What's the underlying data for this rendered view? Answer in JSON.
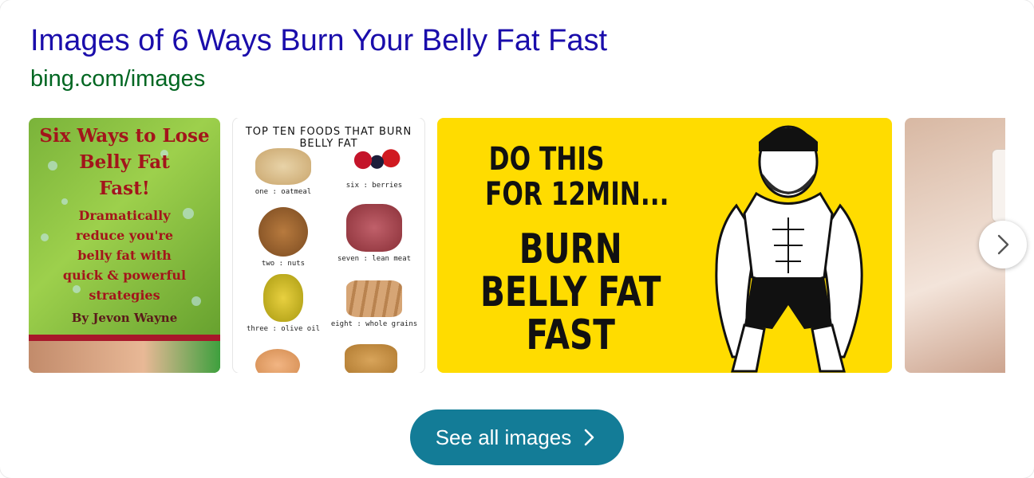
{
  "header": {
    "title": "Images of 6 Ways Burn Your Belly Fat Fast",
    "source": "bing.com/images"
  },
  "images": [
    {
      "heading_lines": [
        "Six Ways to Lose",
        "Belly Fat",
        "Fast!"
      ],
      "body_lines": [
        "Dramatically",
        "reduce you're",
        "belly fat with",
        "quick & powerful",
        "strategies"
      ],
      "author": "By Jevon Wayne"
    },
    {
      "header": "TOP TEN FOODS THAT BURN BELLY FAT",
      "items": [
        {
          "label": "one : oatmeal"
        },
        {
          "label": "six : berries"
        },
        {
          "label": "two : nuts"
        },
        {
          "label": "seven : lean meat"
        },
        {
          "label": "three : olive oil"
        },
        {
          "label": "eight : whole grains"
        }
      ]
    },
    {
      "line1": "DO THIS",
      "line2": "FOR 12MIN...",
      "line3": "BURN",
      "line4": "BELLY FAT",
      "line5": "FAST"
    },
    {}
  ],
  "buttons": {
    "see_all": "See all images"
  },
  "colors": {
    "title": "#1a0dab",
    "source": "#006621",
    "button": "#137c97",
    "poster_yellow": "#ffdc00"
  }
}
